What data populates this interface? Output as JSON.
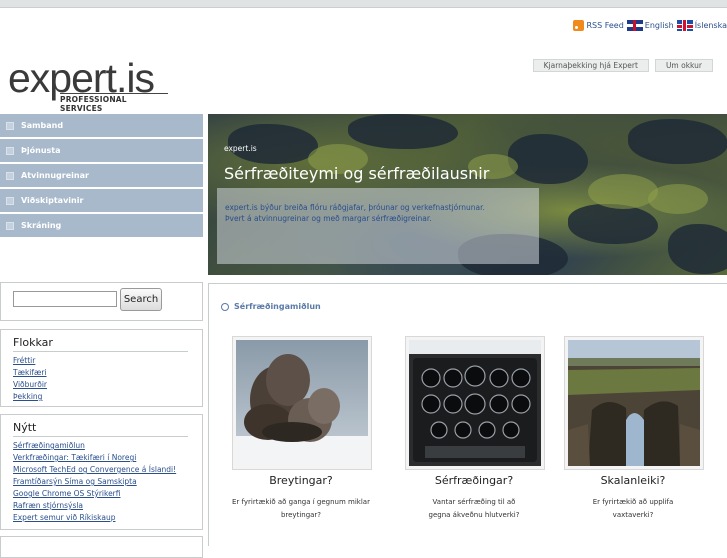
{
  "top_links": {
    "rss": "RSS Feed",
    "english": "English",
    "islenska": "Íslenska"
  },
  "logo": {
    "word": "expert",
    "suffix": ".is",
    "tagline": "PROFESSIONAL SERVICES"
  },
  "top_tabs": [
    "Kjarnaþekking hjá Expert",
    "Um okkur"
  ],
  "left_nav": [
    "Samband",
    "Þjónusta",
    "Atvinnugreinar",
    "Viðskiptavinir",
    "Skráning"
  ],
  "hero": {
    "kicker": "expert.is",
    "title": "Sérfræðiteymi og sérfræðilausnir",
    "text": "expert.is býður breiða flóru ráðgjafar, þróunar og verkefnastjórnunar. Þvert á atvinnugreinar og með margar sérfræðigreinar."
  },
  "search": {
    "button": "Search",
    "value": ""
  },
  "flokkar": {
    "title": "Flokkar",
    "items": [
      "Fréttir",
      "Tækifæri",
      "Viðburðir",
      "Þekking"
    ]
  },
  "nytt": {
    "title": "Nýtt",
    "items": [
      "Sérfræðingamiðlun",
      "Verkfræðingar: Tækifæri í Noregi",
      "Microsoft TechEd og Convergence á Íslandi!",
      "Framtíðarsýn Síma og Samskipta",
      "Google Chrome OS Stýrikerfi",
      "Rafræn stjórnsýsla",
      "Expert semur við Ríkiskaup"
    ]
  },
  "main": {
    "section_title": "Sérfræðingamiðlun",
    "cards": [
      {
        "title": "Breytingar?",
        "desc_line1": "Er fyrirtækið að ganga í gegnum miklar",
        "desc_line2": "breytingar?"
      },
      {
        "title": "Sérfræðingar?",
        "desc_line1": "Vantar sérfræðing til að",
        "desc_line2": "gegna ákveðnu hlutverki?"
      },
      {
        "title": "Skalanleiki?",
        "desc_line1": "Er fyrirtækið að upplifa",
        "desc_line2": "vaxtaverki?"
      }
    ]
  },
  "colors": {
    "nav_bg": "#a9b9cc",
    "link": "#2a4f8c",
    "section_title": "#5a7aa8"
  },
  "icons": [
    "rss-icon",
    "uk-flag-icon",
    "iceland-flag-icon"
  ]
}
